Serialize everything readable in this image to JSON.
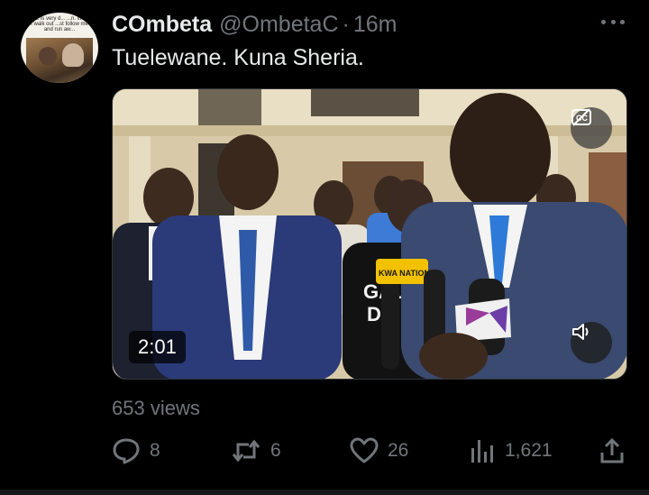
{
  "tweet": {
    "display_name": "COmbeta",
    "handle": "@OmbetaC",
    "separator": "·",
    "time": "16m",
    "text": "Tuelewane. Kuna Sheria.",
    "avatar_meme_text": "...life is very d... ...n. When I walk out ...st follow me and run aw...",
    "more_icon": "ellipsis-icon"
  },
  "media": {
    "duration": "2:01",
    "caption_icon": "captions-off-icon",
    "volume_icon": "volume-icon",
    "mic_brand_text": "KWA NATIONAL",
    "shirt_text": "GAL DE"
  },
  "stats": {
    "views": "653 views",
    "replies": "8",
    "reposts": "6",
    "likes": "26",
    "analytics": "1,621"
  },
  "colors": {
    "background": "#000000",
    "primary_text": "#e7e9ea",
    "secondary_text": "#71767b"
  }
}
